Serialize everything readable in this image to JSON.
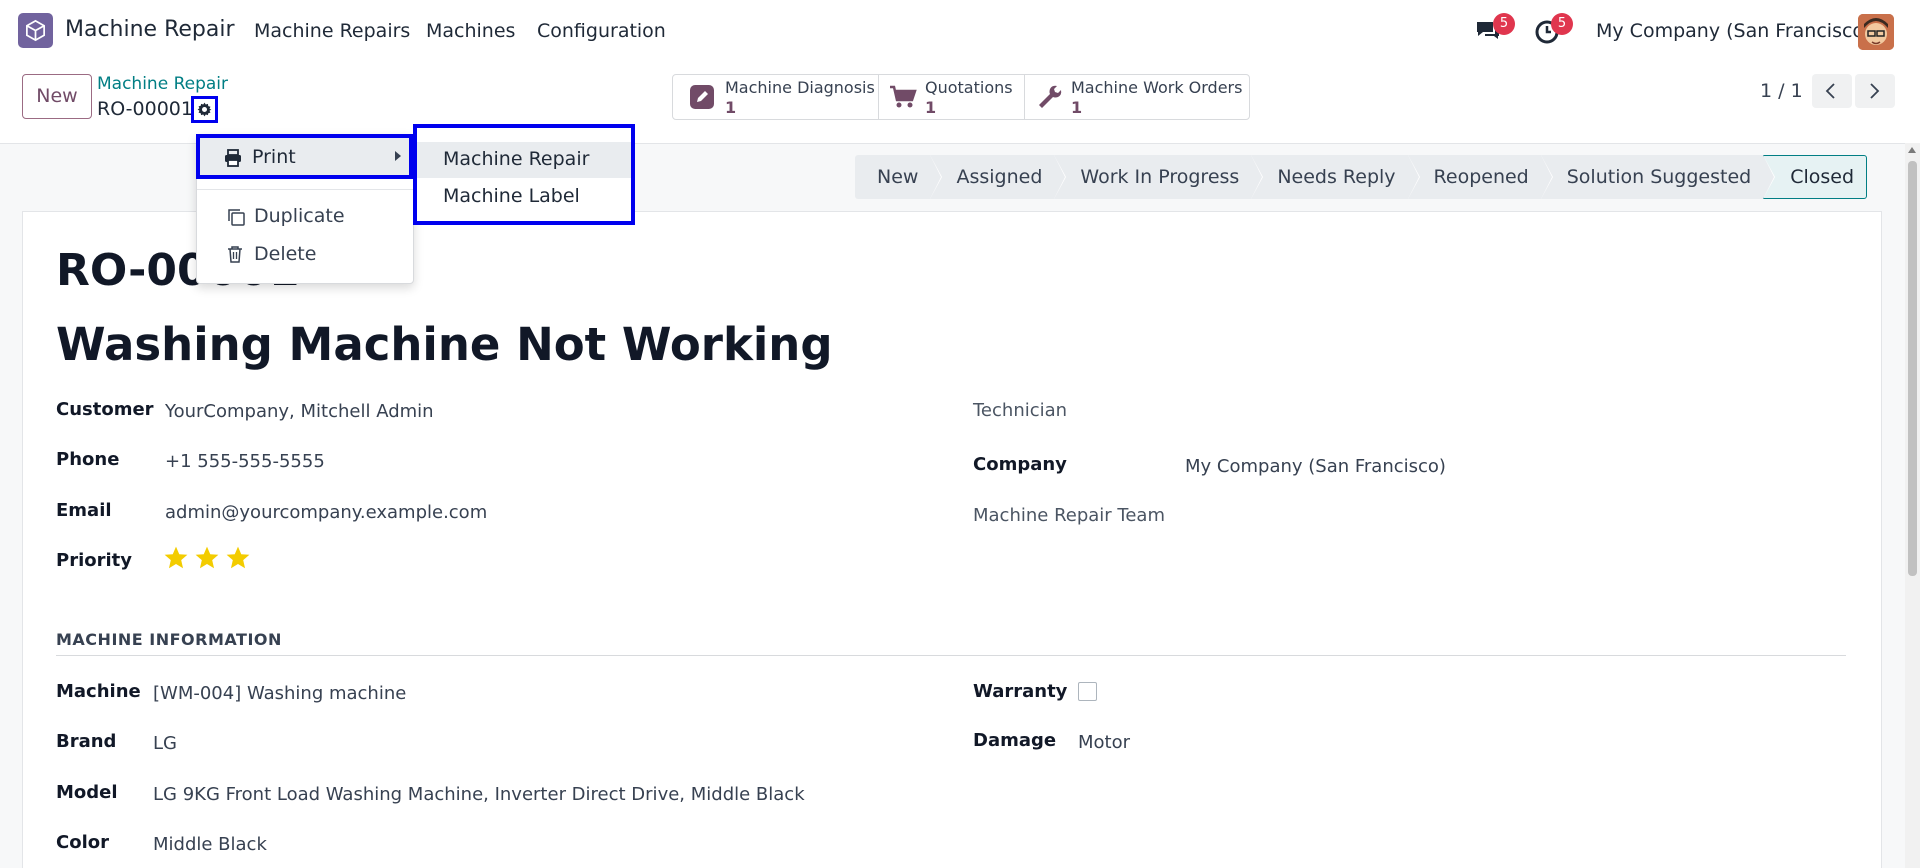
{
  "navbar": {
    "app_name": "Machine Repair",
    "menus": [
      "Machine Repairs",
      "Machines",
      "Configuration"
    ],
    "messages_badge": "5",
    "activities_badge": "5",
    "company": "My Company (San Francisco)"
  },
  "control_panel": {
    "new_label": "New",
    "breadcrumb": "Machine Repair",
    "record_ref": "RO-00001",
    "smart_buttons": [
      {
        "label": "Machine Diagnosis",
        "count": "1",
        "icon": "pencil-square-icon"
      },
      {
        "label": "Quotations",
        "count": "1",
        "icon": "cart-icon"
      },
      {
        "label": "Machine Work Orders",
        "count": "1",
        "icon": "wrench-icon"
      }
    ],
    "pager": "1 / 1"
  },
  "statusbar": {
    "stages": [
      "New",
      "Assigned",
      "Work In Progress",
      "Needs Reply",
      "Reopened",
      "Solution Suggested",
      "Closed"
    ],
    "current": "Closed"
  },
  "form": {
    "reference": "RO-00001",
    "title": "Washing Machine Not Working",
    "customer_label": "Customer",
    "customer": "YourCompany, Mitchell Admin",
    "phone_label": "Phone",
    "phone": "+1 555-555-5555",
    "email_label": "Email",
    "email": "admin@yourcompany.example.com",
    "priority_label": "Priority",
    "priority_stars": 3,
    "technician_label": "Technician",
    "company_label": "Company",
    "company": "My Company (San Francisco)",
    "team_label": "Machine Repair Team",
    "section_machine": "MACHINE INFORMATION",
    "machine_label": "Machine",
    "machine": "[WM-004] Washing machine",
    "brand_label": "Brand",
    "brand": "LG",
    "model_label": "Model",
    "model": "LG 9KG Front Load Washing Machine, Inverter Direct Drive, Middle Black",
    "color_label": "Color",
    "color": "Middle Black",
    "warranty_label": "Warranty",
    "warranty": false,
    "damage_label": "Damage",
    "damage": "Motor"
  },
  "action_menu": {
    "print_label": "Print",
    "duplicate_label": "Duplicate",
    "delete_label": "Delete",
    "print_submenu": [
      "Machine Repair",
      "Machine Label"
    ]
  },
  "colors": {
    "brand": "#714b67",
    "link": "#017e84",
    "highlight": "#0000ee",
    "star": "#f3cc00",
    "badge": "#e0364e"
  }
}
